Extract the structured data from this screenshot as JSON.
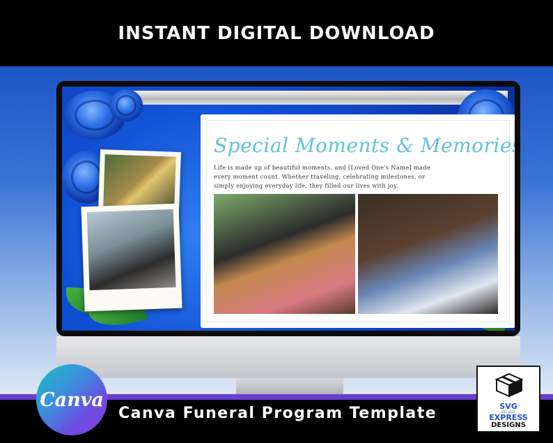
{
  "header": {
    "title": "INSTANT DIGITAL DOWNLOAD"
  },
  "card": {
    "title": "Special Moments & Memories",
    "body": "Life is made up of beautiful moments, and [Loved One's Name] made every moment count. Whether traveling, celebrating milestones, or simply enjoying everyday life, they filled our lives with joy."
  },
  "footer": {
    "title": "Canva Funeral Program Template",
    "canva_logo_text": "Canva",
    "badge": {
      "line1": "SVG",
      "small": "EST. 2021",
      "line2": "EXPRESS",
      "line3": "DESIGNS"
    }
  },
  "colors": {
    "accent_title": "#5fc2dd",
    "stripe": "#6a3fd0",
    "badge_text": "#2350c8"
  }
}
